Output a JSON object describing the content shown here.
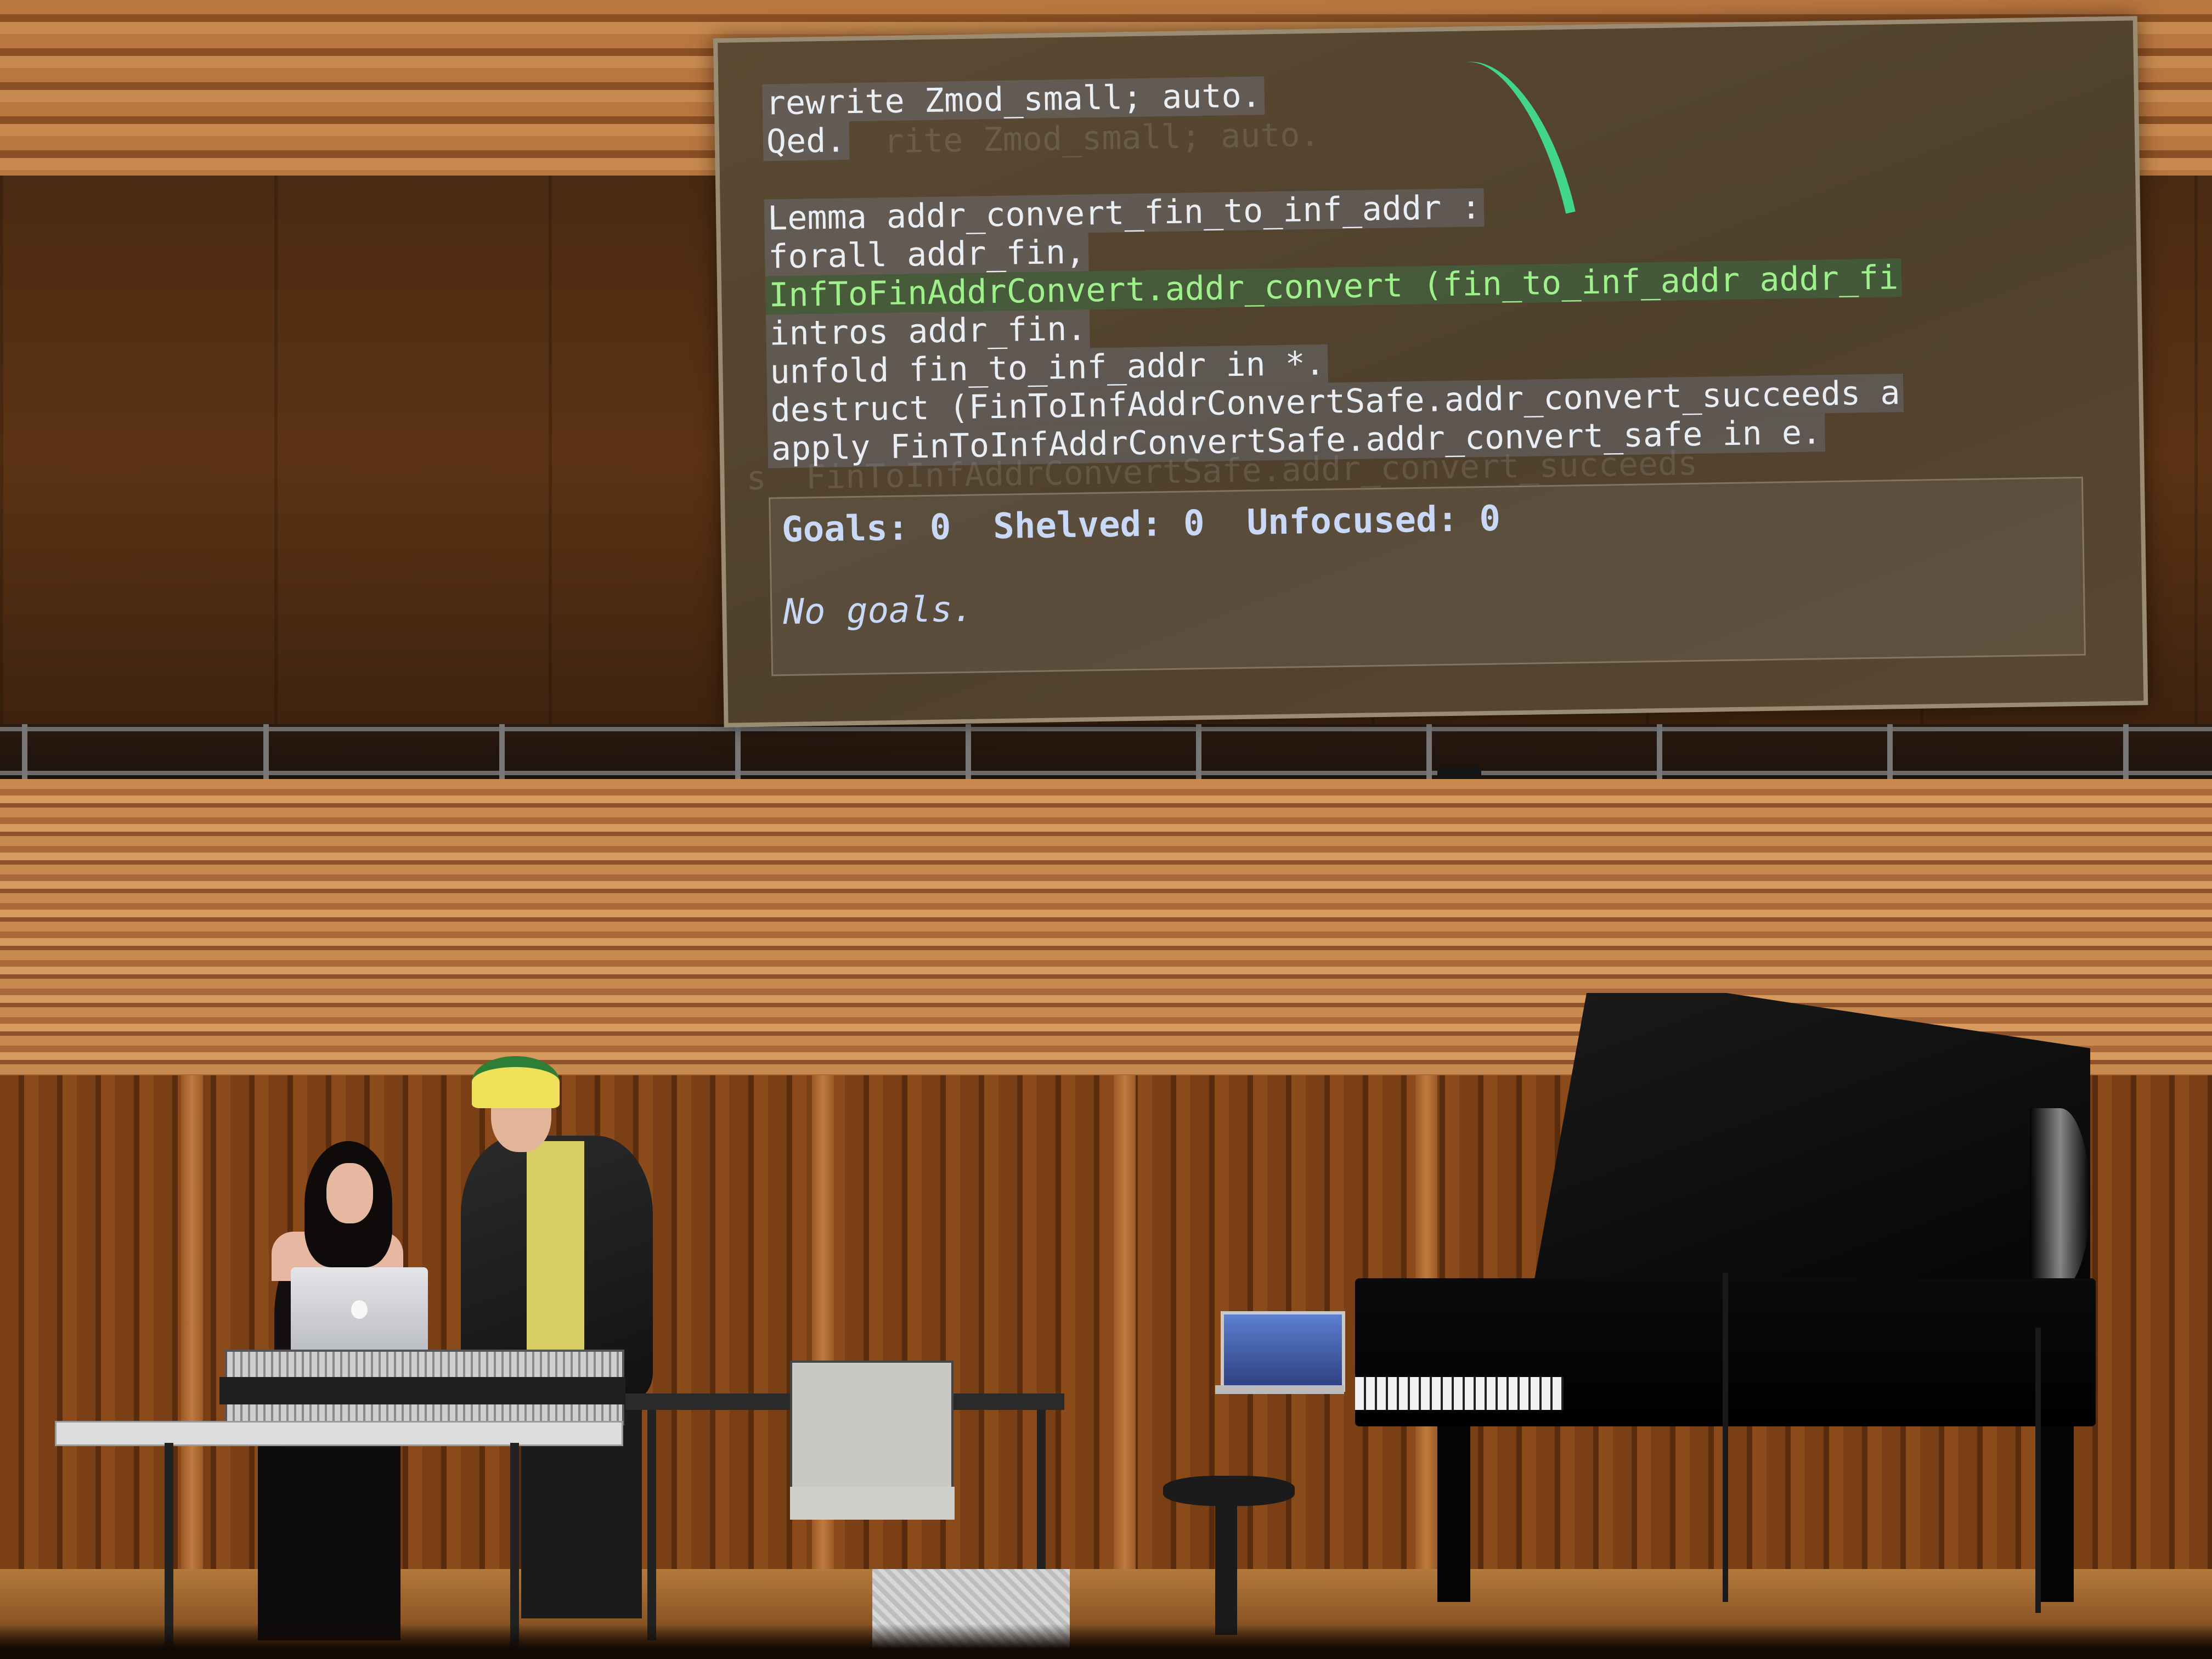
{
  "screen": {
    "code_lines": [
      "rewrite Zmod_small; auto.",
      "Qed.",
      "",
      "Lemma addr_convert_fin_to_inf_addr :",
      "forall addr_fin,",
      "InfToFinAddrConvert.addr_convert (fin_to_inf_addr addr_fi",
      "intros addr_fin.",
      "unfold fin_to_inf_addr in *.",
      "destruct (FinToInfAddrConvertSafe.addr_convert_succeeds a",
      "apply FinToInfAddrConvertSafe.addr_convert_safe in e."
    ],
    "goals_status": "Goals: 0  Shelved: 0  Unfocused: 0",
    "no_goals_message": "No goals."
  },
  "colors": {
    "highlight_text": "#9ef08a",
    "code_text": "#e9eef4",
    "goals_text": "#c8d8f6",
    "cursor_stroke": "#3ff09a"
  }
}
